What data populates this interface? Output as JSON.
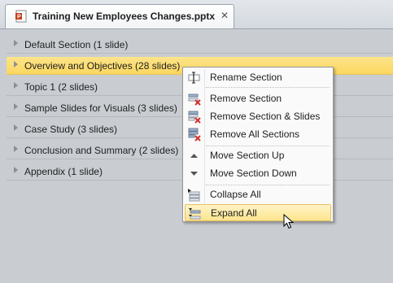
{
  "document_tab": {
    "title": "Training New Employees Changes.pptx",
    "close_glyph": "✕",
    "icon": "powerpoint-file-icon"
  },
  "sections": [
    {
      "label": "Default Section (1 slide)",
      "selected": false
    },
    {
      "label": "Overview and Objectives (28 slides)",
      "selected": true
    },
    {
      "label": "Topic 1 (2 slides)",
      "selected": false
    },
    {
      "label": "Sample Slides for Visuals (3 slides)",
      "selected": false
    },
    {
      "label": "Case Study (3 slides)",
      "selected": false
    },
    {
      "label": "Conclusion and Summary (2 slides)",
      "selected": false
    },
    {
      "label": "Appendix (1 slide)",
      "selected": false
    }
  ],
  "context_menu": {
    "items": [
      {
        "label": "Rename Section",
        "icon": "rename-section-icon"
      },
      {
        "label": "Remove Section",
        "icon": "remove-section-icon"
      },
      {
        "label": "Remove Section & Slides",
        "icon": "remove-section-slides-icon"
      },
      {
        "label": "Remove All Sections",
        "icon": "remove-all-sections-icon"
      },
      {
        "label": "Move Section Up",
        "icon": "move-up-icon"
      },
      {
        "label": "Move Section Down",
        "icon": "move-down-icon"
      },
      {
        "label": "Collapse All",
        "icon": "collapse-all-icon"
      },
      {
        "label": "Expand All",
        "icon": "expand-all-icon",
        "highlighted": true
      }
    ]
  },
  "colors": {
    "selection": "#fbd760",
    "pane_background": "#c9cdd2",
    "remove_red": "#d0312d"
  }
}
